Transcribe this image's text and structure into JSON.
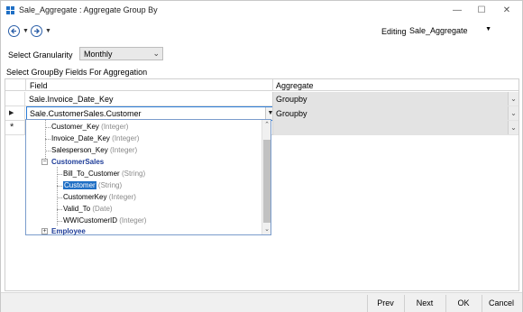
{
  "window": {
    "title": "Sale_Aggregate : Aggregate Group By",
    "minimize_icon": "minimize-icon",
    "maximize_icon": "maximize-icon",
    "close_icon": "close-icon"
  },
  "toolbar": {
    "back_icon": "back-arrow-icon",
    "forward_icon": "forward-arrow-icon",
    "editing_label": "Editing:",
    "editing_value": "Sale_Aggregate"
  },
  "granularity": {
    "label": "Select Granularity",
    "value": "Monthly"
  },
  "groupby": {
    "section_label": "Select GroupBy Fields For Aggregation",
    "columns": [
      "Field",
      "Aggregate"
    ],
    "rows": [
      {
        "field": "Sale.Invoice_Date_Key",
        "aggregate": "Groupby"
      },
      {
        "field": "Sale.CustomerSales.Customer",
        "aggregate": "Groupby"
      },
      {
        "field": "",
        "aggregate": ""
      }
    ]
  },
  "field_dropdown": {
    "items": [
      {
        "name": "Customer_Key",
        "type": "(Integer)"
      },
      {
        "name": "Invoice_Date_Key",
        "type": "(Integer)"
      },
      {
        "name": "Salesperson_Key",
        "type": "(Integer)"
      }
    ],
    "group1": "CustomerSales",
    "group1_items": [
      {
        "name": "Bill_To_Customer",
        "type": "(String)"
      },
      {
        "name": "Customer",
        "type": "(String)"
      },
      {
        "name": "CustomerKey",
        "type": "(Integer)"
      },
      {
        "name": "Valid_To",
        "type": "(Date)"
      },
      {
        "name": "WWICustomerID",
        "type": "(Integer)"
      }
    ],
    "group2": "Employee"
  },
  "footer": {
    "prev": "Prev",
    "next": "Next",
    "ok": "OK",
    "cancel": "Cancel"
  },
  "colors": {
    "accent": "#1f6fc5",
    "group_text": "#1e3d99"
  }
}
